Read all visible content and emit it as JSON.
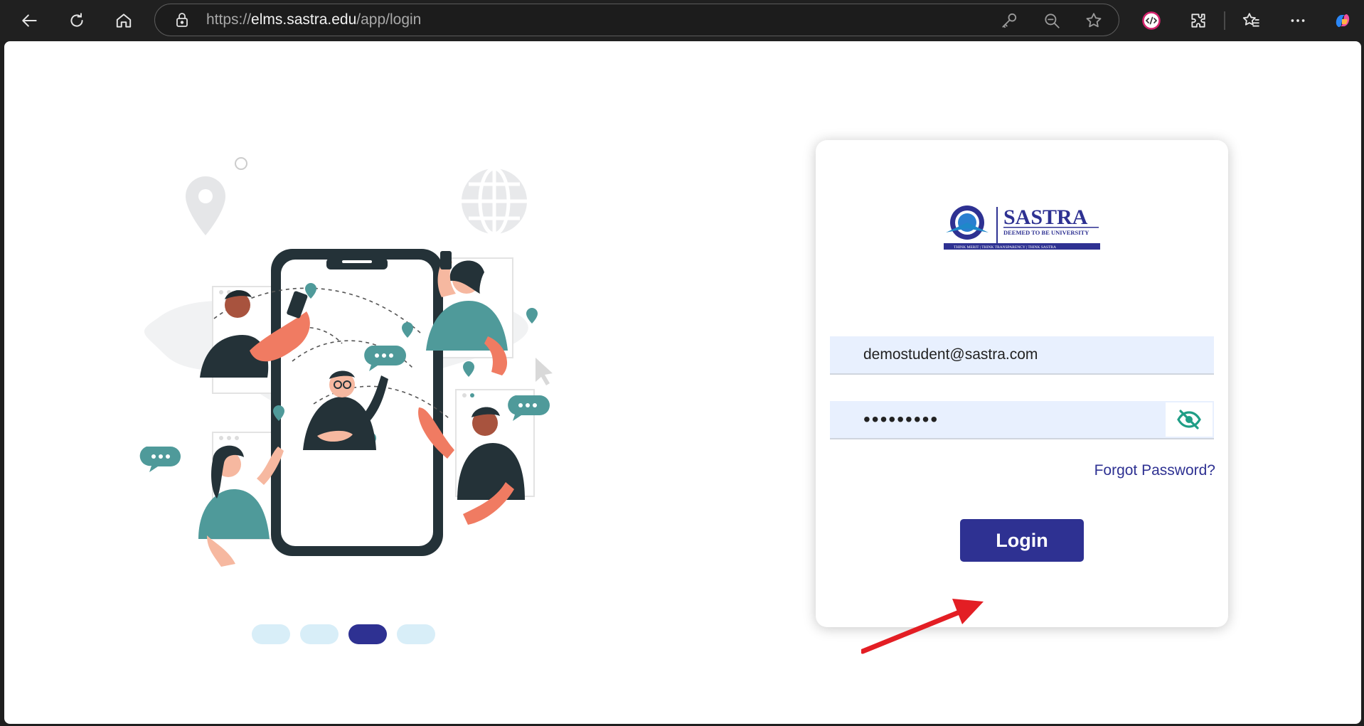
{
  "browser": {
    "url_prefix": "https://",
    "url_domain": "elms.sastra.edu",
    "url_path": "/app/login"
  },
  "carousel": {
    "slide_count": 4,
    "active_index": 2
  },
  "login": {
    "logo_title": "SASTRA",
    "logo_tagline": "DEEMED TO BE UNIVERSITY",
    "logo_motto": "THINK MERIT | THINK TRANSPARENCY | THINK SASTRA",
    "email_value": "demostudent@sastra.com",
    "password_value": "•••••••••",
    "forgot_label": "Forgot Password?",
    "login_label": "Login"
  },
  "colors": {
    "brand": "#2e3192",
    "field_bg": "#e8f0fe",
    "eye_icon": "#1f9e86",
    "annotation_arrow": "#e31e24",
    "illus_teal": "#4f9a9a",
    "illus_coral": "#f07b62",
    "illus_dark": "#243238"
  }
}
